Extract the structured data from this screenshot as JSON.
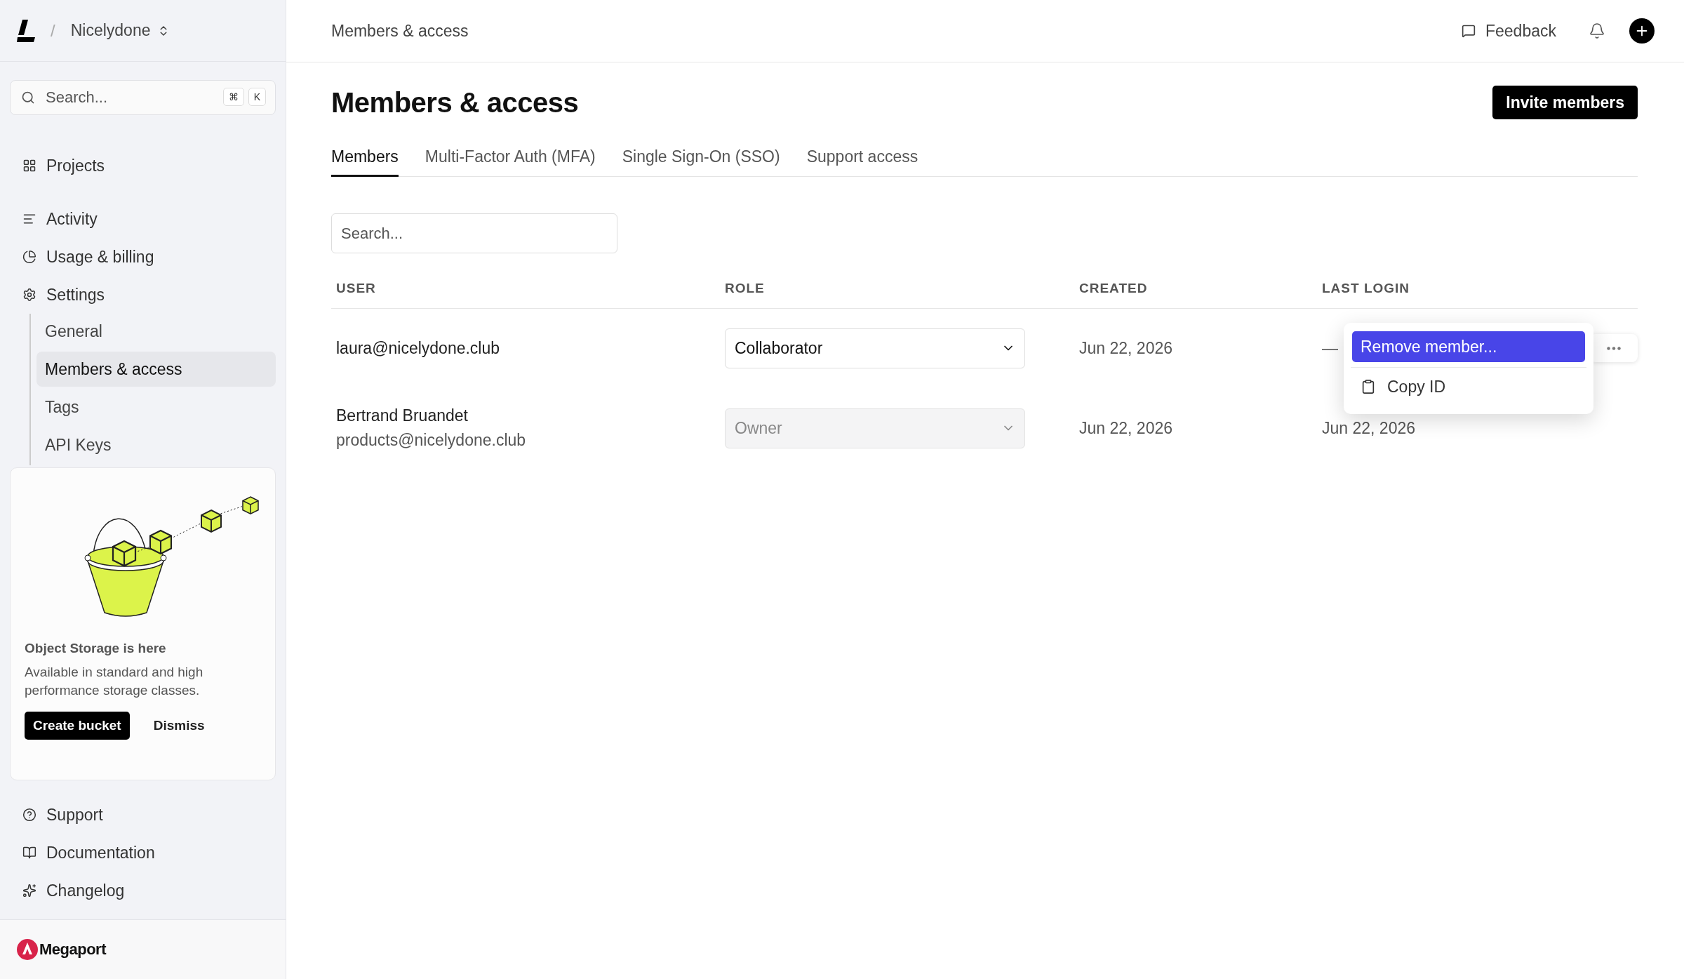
{
  "workspace": {
    "separator": "/",
    "name": "Nicelydone"
  },
  "sidebar": {
    "search": {
      "placeholder": "Search...",
      "keys": [
        "⌘",
        "K"
      ]
    },
    "items": [
      {
        "label": "Projects",
        "selected": false
      },
      {
        "label": "Activity",
        "selected": false
      },
      {
        "label": "Usage & billing",
        "selected": false
      },
      {
        "label": "Settings",
        "selected": false,
        "children": [
          {
            "label": "General",
            "selected": false
          },
          {
            "label": "Members & access",
            "selected": true
          },
          {
            "label": "Tags",
            "selected": false
          },
          {
            "label": "API Keys",
            "selected": false
          }
        ]
      }
    ],
    "promo": {
      "title": "Object Storage is here",
      "text": "Available in standard and high performance storage classes.",
      "primary": "Create bucket",
      "secondary": "Dismiss"
    },
    "footer_items": [
      {
        "label": "Support"
      },
      {
        "label": "Documentation"
      },
      {
        "label": "Changelog"
      }
    ],
    "brand": "Megaport"
  },
  "header": {
    "breadcrumb": "Members & access",
    "feedback": "Feedback"
  },
  "page": {
    "title": "Members & access",
    "invite_button": "Invite members",
    "tabs": [
      {
        "label": "Members",
        "selected": true
      },
      {
        "label": "Multi-Factor Auth (MFA)",
        "selected": false
      },
      {
        "label": "Single Sign-On (SSO)",
        "selected": false
      },
      {
        "label": "Support access",
        "selected": false
      }
    ],
    "search": {
      "placeholder": "Search..."
    },
    "table": {
      "columns": [
        "USER",
        "ROLE",
        "CREATED",
        "LAST LOGIN"
      ],
      "rows": [
        {
          "email": "laura@nicelydone.club",
          "role": "Collaborator",
          "disabled": false,
          "created": "Jun 22, 2026",
          "last_login": "—",
          "menu": {
            "items": [
              {
                "label": "Remove member...",
                "selected": true
              },
              {
                "label": "Copy ID",
                "selected": false
              }
            ]
          }
        },
        {
          "name": "Bertrand Bruandet",
          "email": "products@nicelydone.club",
          "role": "Owner",
          "disabled": true,
          "created": "Jun 22, 2026",
          "last_login": "Jun 22, 2026"
        }
      ]
    }
  }
}
